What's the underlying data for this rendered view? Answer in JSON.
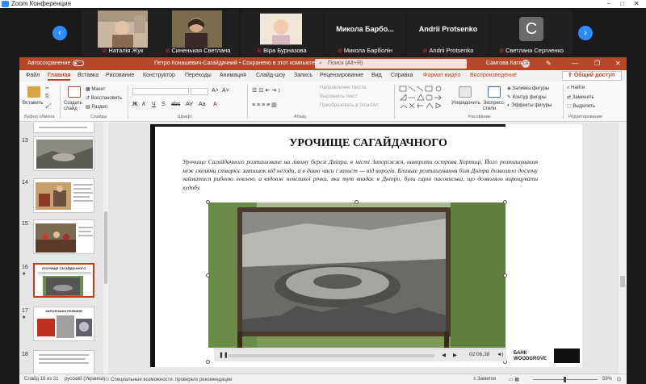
{
  "zoom": {
    "window_title": "Zoom Конференция",
    "window_controls": [
      "–",
      "□",
      "✕"
    ],
    "participants": [
      {
        "name": "Наталія Жук",
        "muted": true,
        "type": "video"
      },
      {
        "name": "Синенькая Светлана",
        "muted": true,
        "type": "video"
      },
      {
        "name": "Віра Бурназова",
        "muted": true,
        "type": "video"
      },
      {
        "name": "Микола Барболін",
        "display": "Микола Барбо...",
        "muted": true,
        "type": "name"
      },
      {
        "name": "Andrii Protsenko",
        "display": "Andrii Protsenko",
        "muted": true,
        "type": "name"
      },
      {
        "name": "Светлана Сергиенко",
        "letter": "С",
        "muted": true,
        "type": "letter"
      }
    ],
    "nav_prev": "‹",
    "nav_next": "›"
  },
  "ppt": {
    "autosave_label": "Автосохранение",
    "document_title": "Петро Конашевич-Сагайдачний • Сохранено в этот компьютер ∨",
    "search_placeholder": "Поиск (Alt+Я)",
    "user_name": "Самгова Катя",
    "user_initials": "СК",
    "title_buttons": [
      "✎",
      "—",
      "❐",
      "✕"
    ],
    "tabs": [
      "Файл",
      "Главная",
      "Вставка",
      "Рисование",
      "Конструктор",
      "Переходы",
      "Анимация",
      "Слайд-шоу",
      "Запись",
      "Рецензирование",
      "Вид",
      "Справка",
      "Формат видео",
      "Воспроизведение"
    ],
    "active_tab": "Главная",
    "share_label": "Общий доступ",
    "ribbon": {
      "paste": "Вставить",
      "new_slide": "Создать слайд",
      "layout": "Макет",
      "reset": "Восстановить",
      "section": "Раздел",
      "group_clipboard": "Буфер обмена",
      "group_slides": "Слайды",
      "group_font": "Шрифт",
      "group_paragraph": "Абзац",
      "group_drawing": "Рисование",
      "group_editing": "Редактирование",
      "text_direction": "Направление текста",
      "align_text": "Выровнять текст",
      "smartart": "Преобразовать в SmartArt",
      "arrange": "Упорядочить",
      "quick_styles": "Экспресс-стили",
      "shape_fill": "Заливка фигуры",
      "shape_outline": "Контур фигуры",
      "shape_effects": "Эффекты фигуры",
      "find": "Найти",
      "replace": "Заменить",
      "select": "Выделить"
    },
    "thumbnails": [
      {
        "num": "13",
        "title": ""
      },
      {
        "num": "14",
        "title": ""
      },
      {
        "num": "15",
        "title": ""
      },
      {
        "num": "16",
        "title": "УРОЧИЩЕ САГАЙДАЧНОГО",
        "selected": true
      },
      {
        "num": "17",
        "title": "ЗАПОРІЗЬКА РЕЛІКВІЯ"
      },
      {
        "num": "18",
        "title": ""
      }
    ],
    "slide": {
      "title": "УРОЧИЩЕ САГАЙДАЧНОГО",
      "body": "Урочище Сагайдачного розташоване на лівому березі Дніпра, в місті Запоріжжя, навпроти острова Хортиці. Його розташування між скелями створює затишок від негоди, а в давні часи і захист — від ворогів. Близьке розташування біля Дніпра дозволяло досхочу займатися рибною ловлею, а вздовж невеликої річки, яка тут впадає в Дніпро, були гарні пасовиська, що дозволяло вирощувати худобу.",
      "video_time": "02:06,38",
      "brand_line1": "БАНК",
      "brand_line2": "WOODGROVE"
    },
    "status": {
      "slide_count": "Слайд 16 из 21",
      "language": "русский (Украина)",
      "accessibility": "Специальные возможности: проверьте рекомендации",
      "notes": "≡ Заметки",
      "zoom": "59%"
    }
  }
}
